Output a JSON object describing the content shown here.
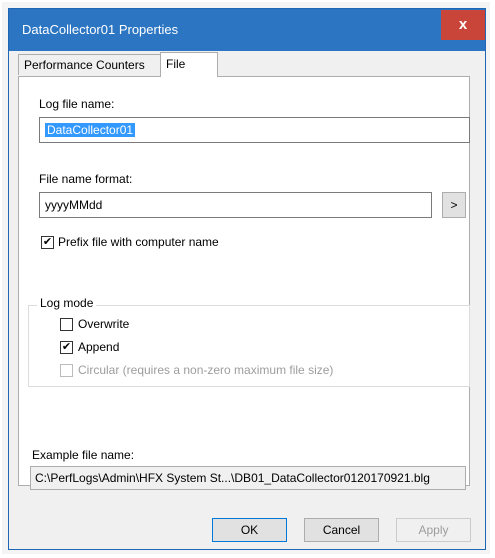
{
  "window": {
    "title": "DataCollector01 Properties",
    "close_glyph": "x"
  },
  "tabs": [
    {
      "label": "Performance Counters"
    },
    {
      "label": "File"
    }
  ],
  "log_file_name": {
    "label": "Log file name:",
    "value": "DataCollector01"
  },
  "file_name_format": {
    "label": "File name format:",
    "value": "yyyyMMdd",
    "button_label": ">"
  },
  "prefix_checkbox": {
    "label": "Prefix file with computer name",
    "checked": true
  },
  "log_mode": {
    "title": "Log mode",
    "options": [
      {
        "label": "Overwrite",
        "checked": false,
        "enabled": true
      },
      {
        "label": "Append",
        "checked": true,
        "enabled": true
      },
      {
        "label": "Circular (requires a non-zero maximum file size)",
        "checked": false,
        "enabled": false
      }
    ]
  },
  "example": {
    "label": "Example file name:",
    "value": "C:\\PerfLogs\\Admin\\HFX System St...\\DB01_DataCollector0120170921.blg"
  },
  "buttons": {
    "ok": "OK",
    "cancel": "Cancel",
    "apply": "Apply"
  },
  "colors": {
    "titlebar": "#2b75c2",
    "close": "#c9453a",
    "selection": "#3399ff"
  }
}
